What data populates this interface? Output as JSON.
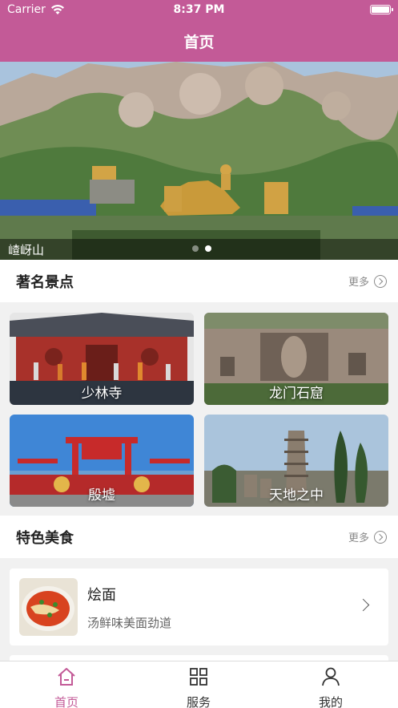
{
  "status_bar": {
    "carrier": "Carrier",
    "time": "8:37 PM"
  },
  "nav": {
    "title": "首页"
  },
  "banner": {
    "caption": "嵖岈山",
    "page_count": 2,
    "active_page": 2
  },
  "attractions": {
    "title": "著名景点",
    "more_label": "更多",
    "items": [
      {
        "label": "少林寺"
      },
      {
        "label": "龙门石窟"
      },
      {
        "label": "殷墟"
      },
      {
        "label": "天地之中"
      }
    ]
  },
  "food": {
    "title": "特色美食",
    "more_label": "更多",
    "items": [
      {
        "name": "烩面",
        "desc": "汤鲜味美面劲道"
      }
    ]
  },
  "tabbar": {
    "items": [
      {
        "label": "首页",
        "icon": "home-icon",
        "active": true
      },
      {
        "label": "服务",
        "icon": "grid-icon",
        "active": false
      },
      {
        "label": "我的",
        "icon": "person-icon",
        "active": false
      }
    ]
  },
  "colors": {
    "accent": "#c35a97",
    "background": "#f1f1f1"
  }
}
